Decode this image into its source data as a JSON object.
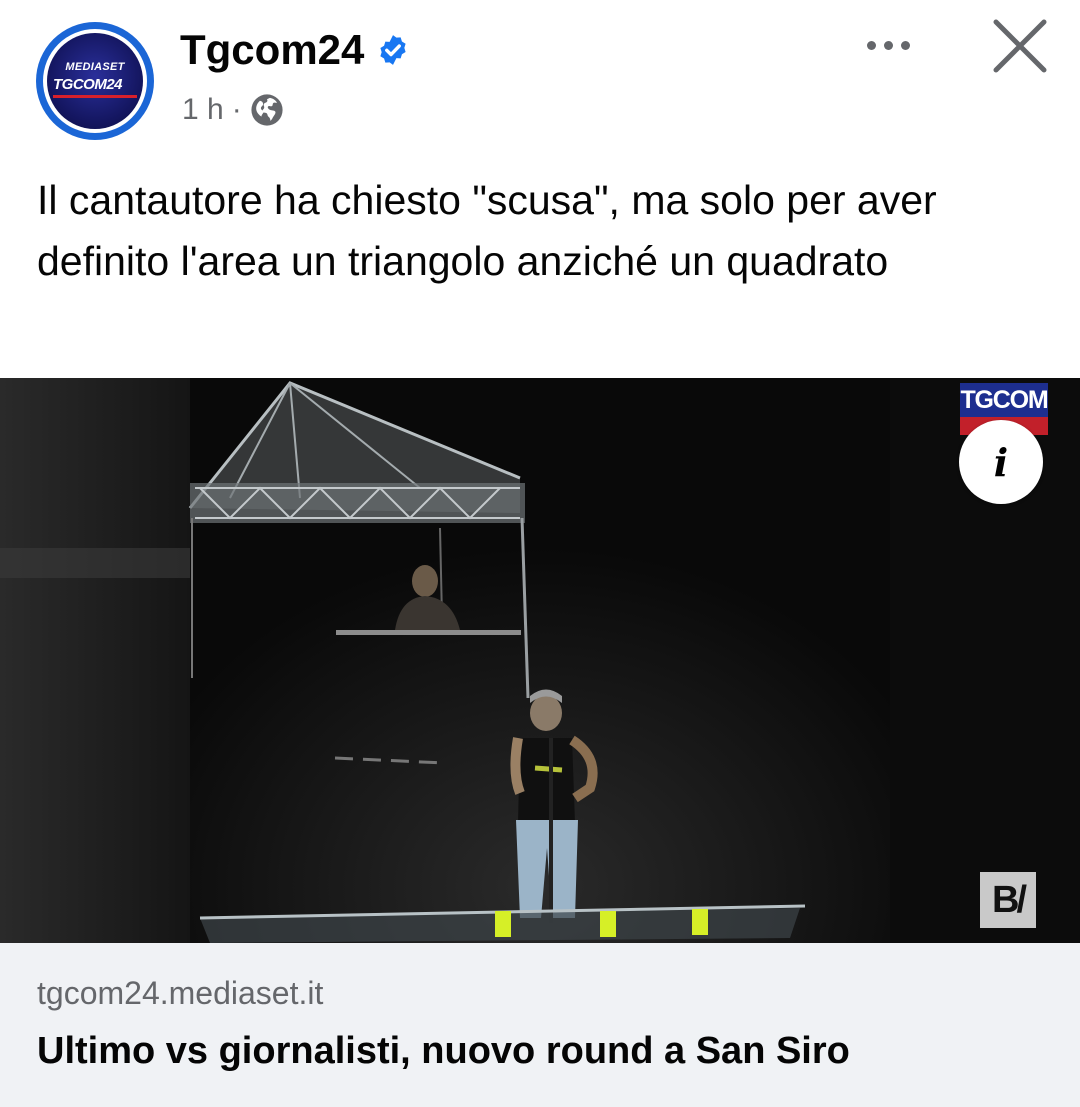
{
  "post": {
    "page_name": "Tgcom24",
    "time": "1 h",
    "separator": "·",
    "avatar_text_top": "MEDIASET",
    "avatar_text_main": "TGCOM24",
    "caption": "Il cantautore ha chiesto \"scusa\", ma solo per aver definito l'area un triangolo anziché un quadrato",
    "icons": {
      "verified": "verified-badge-icon",
      "audience": "globe-icon",
      "more": "more-options-icon",
      "close": "close-icon",
      "info": "info-icon"
    },
    "colors": {
      "verified": "#1877f2",
      "brand_blue": "#1d2e8f",
      "brand_red": "#c2202a"
    }
  },
  "media": {
    "watermark_top": "TGCOM",
    "watermark_bottom": "B/"
  },
  "link_preview": {
    "domain": "tgcom24.mediaset.it",
    "title": "Ultimo vs giornalisti, nuovo round a San Siro"
  }
}
